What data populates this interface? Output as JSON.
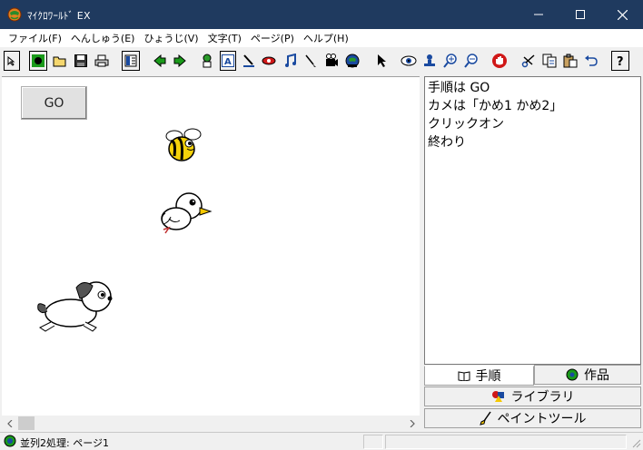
{
  "window": {
    "title": "ﾏｲｸﾛﾜｰﾙﾄﾞ EX"
  },
  "menu": [
    "ファイル(F)",
    "へんしゅう(E)",
    "ひょうじ(V)",
    "文字(T)",
    "ページ(P)",
    "ヘルプ(H)"
  ],
  "toolbar": {
    "icons": [
      "pointer-icon",
      "world-icon",
      "open-folder-icon",
      "save-icon",
      "print-icon",
      "list-icon",
      "prev-page-icon",
      "next-page-icon",
      "character-icon",
      "text-icon",
      "pen-icon",
      "eye-mask-icon",
      "music-icon",
      "paint-brush-icon",
      "film-icon",
      "globe-icon",
      "arrow-cursor-icon",
      "view-eye-icon",
      "stamp-icon",
      "zoom-in-icon",
      "zoom-out-icon",
      "stop-hand-icon",
      "cut-icon",
      "copy-icon",
      "paste-icon",
      "undo-icon",
      "help-icon"
    ]
  },
  "stage": {
    "go_label": "GO",
    "sprites": [
      "bee",
      "bird",
      "dog"
    ]
  },
  "script": {
    "lines": [
      "手順は GO",
      "カメは「かめ1 かめ2」",
      "クリックオン",
      "終わり"
    ]
  },
  "tabs": {
    "procedure_label": "手順",
    "works_label": "作品",
    "library_label": "ライブラリ",
    "paint_tool_label": "ペイントツール"
  },
  "status": {
    "text": "並列2処理: ページ1"
  },
  "colors": {
    "titlebar": "#1f3a5f",
    "toolbar_green": "#1a9a1a",
    "stop_red": "#d01818"
  }
}
